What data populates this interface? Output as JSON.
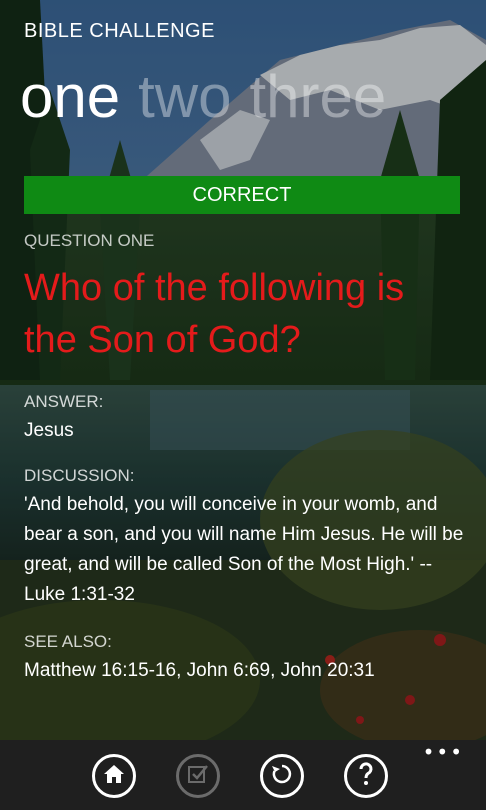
{
  "app": {
    "title": "BIBLE CHALLENGE"
  },
  "pivot": {
    "items": [
      {
        "label": "one",
        "active": true
      },
      {
        "label": "two",
        "active": false
      },
      {
        "label": "three",
        "active": false
      }
    ]
  },
  "result": {
    "label": "CORRECT",
    "color": "#0f8a14"
  },
  "question": {
    "label": "QUESTION ONE",
    "text": "Who of the following is the Son of God?",
    "color": "#e41b1b"
  },
  "answer": {
    "label": "ANSWER:",
    "text": "Jesus"
  },
  "discussion": {
    "label": "DISCUSSION:",
    "text": "'And behold, you will conceive in your womb, and bear a son, and you will name Him Jesus.  He will be great, and will be called Son of the Most High.' -- Luke 1:31-32"
  },
  "see_also": {
    "label": "SEE ALSO:",
    "text": "Matthew 16:15-16, John 6:69, John 20:31"
  },
  "appbar": {
    "buttons": [
      {
        "icon": "home-icon",
        "enabled": true
      },
      {
        "icon": "check-answer-icon",
        "enabled": false
      },
      {
        "icon": "refresh-icon",
        "enabled": true
      },
      {
        "icon": "help-icon",
        "enabled": true
      }
    ],
    "more": "•••"
  }
}
